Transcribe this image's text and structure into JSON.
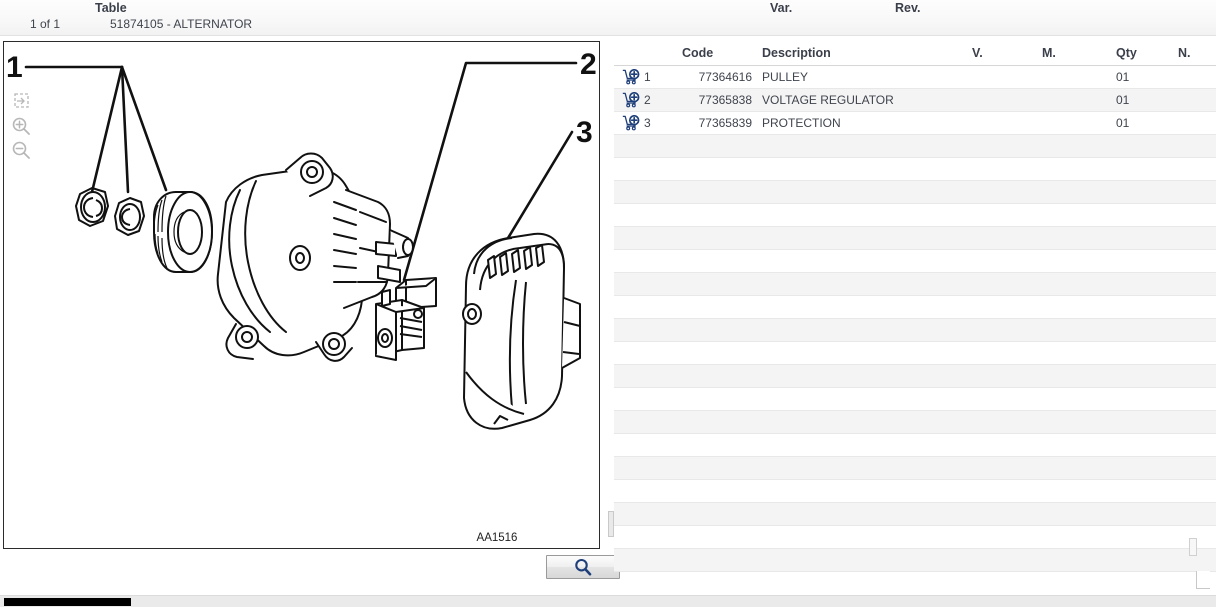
{
  "header": {
    "table_label": "Table",
    "var_label": "Var.",
    "rev_label": "Rev.",
    "page_indicator": "1 of 1",
    "table_value": "51874105 - ALTERNATOR"
  },
  "diagram": {
    "drawing_code": "AA1516",
    "callouts": [
      "1",
      "2",
      "3"
    ],
    "zoom_tools": [
      {
        "name": "fit-to-window-icon",
        "title": "Fit"
      },
      {
        "name": "zoom-in-icon",
        "title": "Zoom In"
      },
      {
        "name": "zoom-out-icon",
        "title": "Zoom Out"
      }
    ]
  },
  "search": {
    "button_title": "Search"
  },
  "parts_table": {
    "columns": [
      "",
      "",
      "Code",
      "Description",
      "V.",
      "M.",
      "Qty",
      "N."
    ],
    "rows": [
      {
        "pos": "1",
        "code": "77364616",
        "description": "PULLEY",
        "v": "",
        "m": "",
        "qty": "01",
        "n": ""
      },
      {
        "pos": "2",
        "code": "77365838",
        "description": "VOLTAGE REGULATOR",
        "v": "",
        "m": "",
        "qty": "01",
        "n": ""
      },
      {
        "pos": "3",
        "code": "77365839",
        "description": "PROTECTION",
        "v": "",
        "m": "",
        "qty": "01",
        "n": ""
      }
    ],
    "empty_row_count": 19,
    "cart_icon": "add-to-cart-icon"
  },
  "colors": {
    "accent_blue": "#1f3f7a",
    "header_text": "#3a3f4a",
    "row_stripe": "#f4f4f4",
    "diagram_line": "#111111"
  }
}
